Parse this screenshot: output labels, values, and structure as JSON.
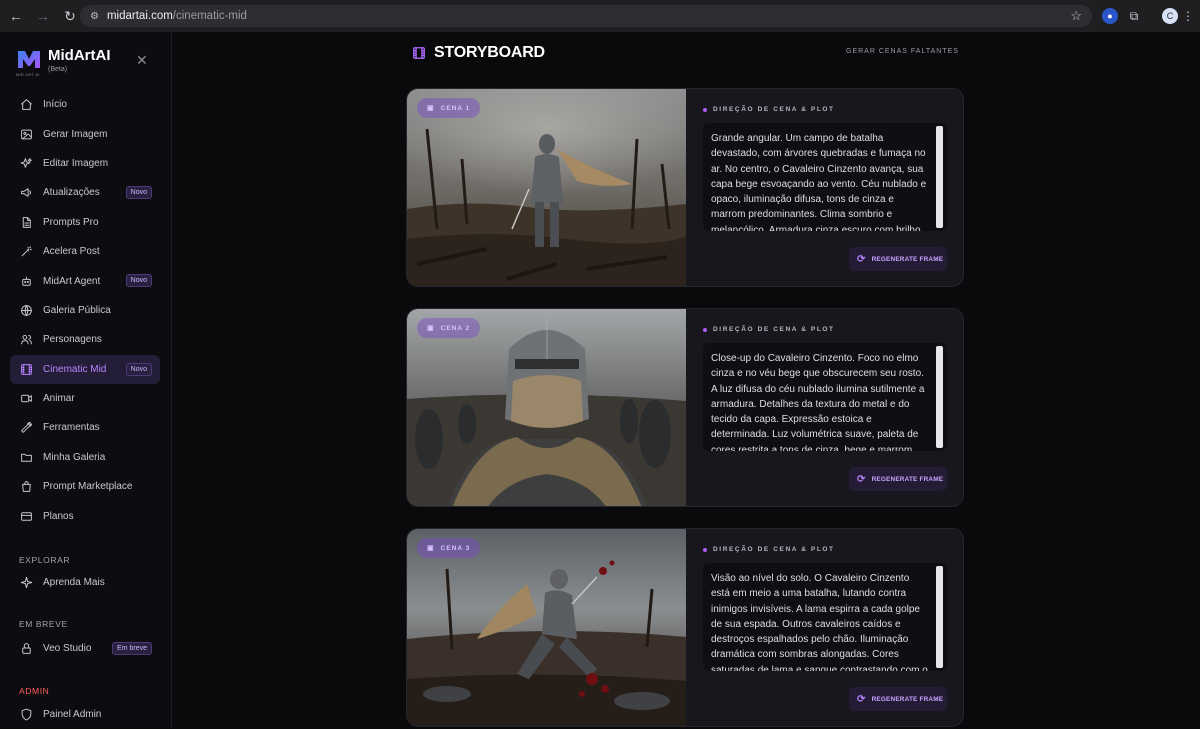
{
  "browser": {
    "url_host": "midartai.com",
    "url_path": "/cinematic-mid",
    "profile_initial": "C"
  },
  "brand": {
    "name": "MidArtAI",
    "sub": "(Beta)",
    "tiny": "MID ART AI"
  },
  "menu": [
    {
      "label": "Início",
      "icon": "home-icon"
    },
    {
      "label": "Gerar Imagem",
      "icon": "image-icon"
    },
    {
      "label": "Editar Imagem",
      "icon": "sparkles-icon"
    },
    {
      "label": "Atualizações",
      "icon": "megaphone-icon",
      "badge": "Novo"
    },
    {
      "label": "Prompts Pro",
      "icon": "document-icon"
    },
    {
      "label": "Acelera Post",
      "icon": "magic-wand-icon"
    },
    {
      "label": "MidArt Agent",
      "icon": "robot-icon",
      "badge": "Novo"
    },
    {
      "label": "Galeria Pública",
      "icon": "globe-icon"
    },
    {
      "label": "Personagens",
      "icon": "users-icon"
    },
    {
      "label": "Cinematic Mid",
      "icon": "film-icon",
      "badge": "Novo",
      "active": true
    },
    {
      "label": "Animar",
      "icon": "video-icon"
    },
    {
      "label": "Ferramentas",
      "icon": "wrench-icon"
    },
    {
      "label": "Minha Galeria",
      "icon": "folder-icon"
    },
    {
      "label": "Prompt Marketplace",
      "icon": "shopping-bag-icon"
    },
    {
      "label": "Planos",
      "icon": "credit-card-icon"
    }
  ],
  "explore": {
    "label": "EXPLORAR",
    "items": [
      {
        "label": "Aprenda Mais",
        "icon": "sparkle-icon"
      }
    ]
  },
  "soon": {
    "label": "EM BREVE",
    "items": [
      {
        "label": "Veo Studio",
        "icon": "lock-icon",
        "badge": "Em breve"
      }
    ]
  },
  "admin": {
    "label": "ADMIN",
    "items": [
      {
        "label": "Painel Admin",
        "icon": "shield-icon"
      }
    ]
  },
  "storyboard": {
    "title": "STORYBOARD",
    "generate_missing": "GERAR CENAS FALTANTES",
    "panel_heading": "DIREÇÃO DE CENA & PLOT",
    "regenerate_label": "REGENERATE FRAME",
    "scenes": [
      {
        "tag": "CENA 1",
        "description": "Grande angular. Um campo de batalha devastado, com árvores quebradas e fumaça no ar. No centro, o Cavaleiro Cinzento avança, sua capa bege esvoaçando ao vento. Céu nublado e opaco, iluminação difusa, tons de cinza e marrom predominantes. Clima sombrio e melancólico. Armadura cinza escuro com brilho sutil. Foco na"
      },
      {
        "tag": "CENA 2",
        "description": "Close-up do Cavaleiro Cinzento. Foco no elmo cinza e no véu bege que obscurecem seu rosto. A luz difusa do céu nublado ilumina sutilmente a armadura. Detalhes da textura do metal e do tecido da capa. Expressão estoica e determinada. Luz volumétrica suave, paleta de cores restrita a tons de cinza, bege e marrom escuro."
      },
      {
        "tag": "CENA 3",
        "description": "Visão ao nível do solo. O Cavaleiro Cinzento está em meio a uma batalha, lutando contra inimigos invisíveis. A lama espirra a cada golpe de sua espada. Outros cavaleiros caídos e destroços espalhados pelo chão. Iluminação dramática com sombras alongadas. Cores saturadas de lama e sangue contrastando com o cinza da armadura."
      }
    ]
  }
}
